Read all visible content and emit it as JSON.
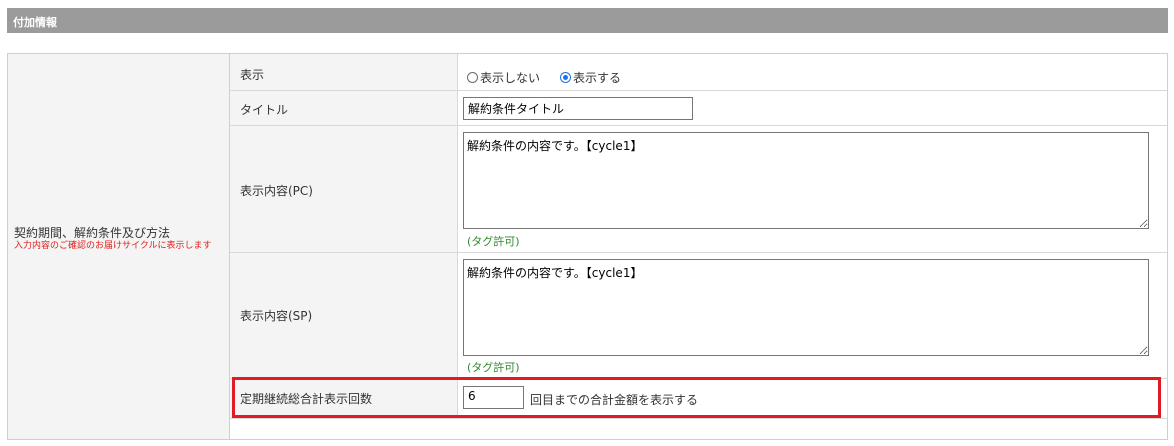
{
  "section": {
    "title": "付加情報"
  },
  "group": {
    "title": "契約期間、解約条件及び方法",
    "note": "入力内容のご確認のお届けサイクルに表示します"
  },
  "rows": {
    "display": {
      "label": "表示",
      "options": [
        {
          "label": "表示しない",
          "selected": false
        },
        {
          "label": "表示する",
          "selected": true
        }
      ]
    },
    "title": {
      "label": "タイトル",
      "value": "解約条件タイトル"
    },
    "content_pc": {
      "label": "表示内容(PC)",
      "value": "解約条件の内容です。【cycle1】",
      "tag_note": "(タグ許可)"
    },
    "content_sp": {
      "label": "表示内容(SP)",
      "value": "解約条件の内容です。【cycle1】",
      "tag_note": "(タグ許可)"
    },
    "total_count": {
      "label": "定期継続総合計表示回数",
      "value": "6",
      "suffix": "回目までの合計金額を表示する"
    }
  },
  "colors": {
    "header_bg": "#9b9b9b",
    "highlight": "#e01b24",
    "tag_note": "#2d8a2d",
    "note": "#e02020"
  }
}
